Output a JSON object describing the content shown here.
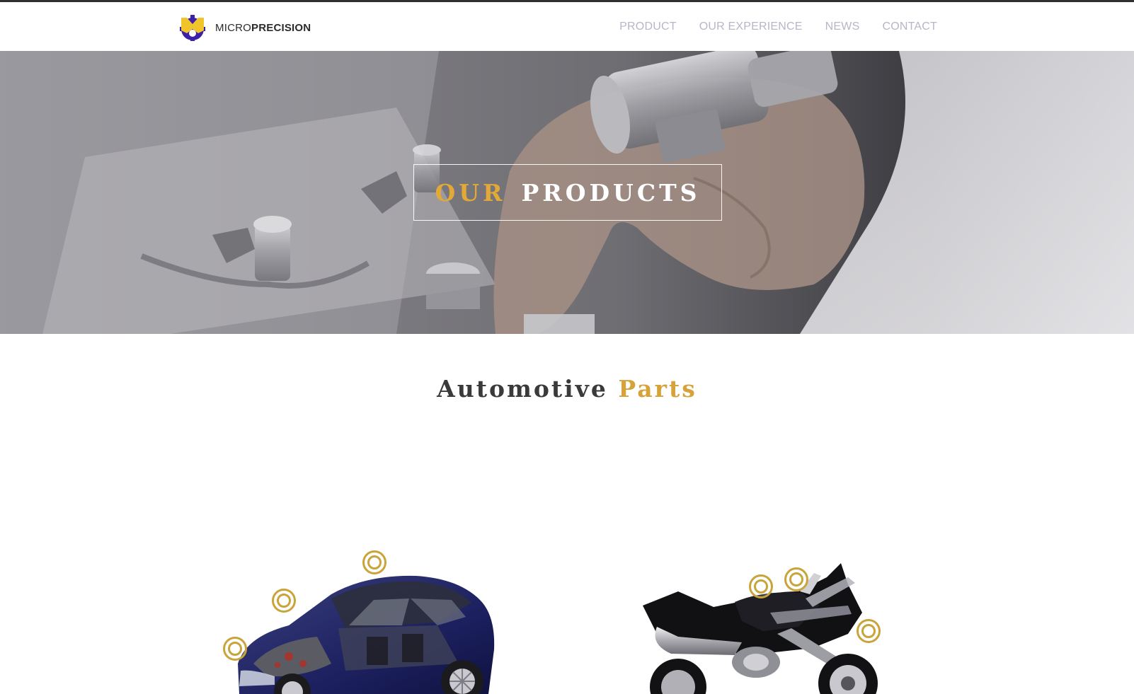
{
  "brand": {
    "name_light": "MICRO",
    "name_bold": "PRECISION",
    "logo_icon": "gear-m-logo-icon",
    "colors": {
      "yellow": "#f0c52b",
      "purple": "#3d1fa8"
    }
  },
  "nav": {
    "items": [
      {
        "label": "PRODUCT"
      },
      {
        "label": "OUR EXPERIENCE"
      },
      {
        "label": "NEWS"
      },
      {
        "label": "CONTACT"
      }
    ]
  },
  "hero": {
    "title_accent": "OUR",
    "title_main": "PRODUCTS",
    "accent_color": "#e2a838"
  },
  "section": {
    "title_main": "Automotive",
    "title_accent": "Parts",
    "accent_color": "#d6a33a"
  },
  "vehicles": [
    {
      "name": "car",
      "icon": "car-cutaway-icon",
      "hotspots": 3
    },
    {
      "name": "motorcycle",
      "icon": "motorcycle-icon",
      "hotspots": 3
    }
  ]
}
